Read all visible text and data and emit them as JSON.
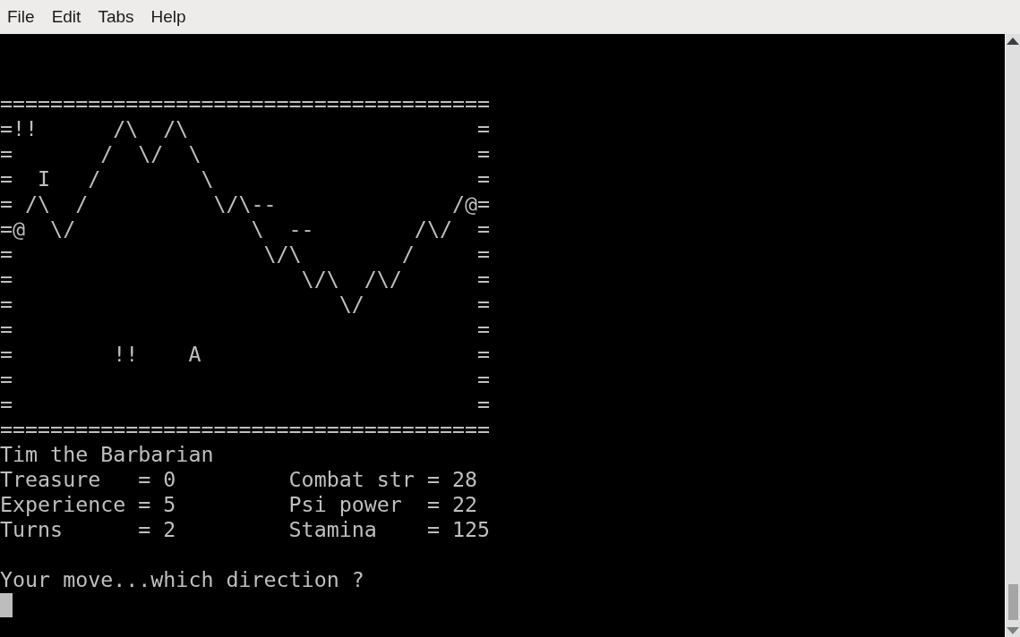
{
  "menu": [
    {
      "label": "File"
    },
    {
      "label": "Edit"
    },
    {
      "label": "Tabs"
    },
    {
      "label": "Help"
    }
  ],
  "terminal": {
    "lines": [
      {
        "kind": "text",
        "text": "======================================="
      },
      {
        "kind": "text",
        "text": "=!!      /\\  /\\                       ="
      },
      {
        "kind": "text",
        "text": "=       /  \\/  \\                      ="
      },
      {
        "kind": "text",
        "text": "=  I   /        \\                     ="
      },
      {
        "kind": "text",
        "text": "= /\\  /          \\/\\--              /@="
      },
      {
        "kind": "text",
        "text": "=@  \\/              \\  --        /\\/  ="
      },
      {
        "kind": "text",
        "text": "=                    \\/\\        /     ="
      },
      {
        "kind": "text",
        "text": "=                       \\/\\  /\\/      ="
      },
      {
        "kind": "text",
        "text": "=                          \\/         ="
      },
      {
        "kind": "text",
        "text": "=                                     ="
      },
      {
        "kind": "text",
        "text": "=        !!    A                      ="
      },
      {
        "kind": "text",
        "text": "=                                     ="
      },
      {
        "kind": "text",
        "text": "=                                     ="
      },
      {
        "kind": "text",
        "text": "======================================="
      },
      {
        "kind": "text",
        "text": "Tim the Barbarian"
      },
      {
        "kind": "text",
        "text": "Treasure   = 0         Combat str = 28"
      },
      {
        "kind": "text",
        "text": "Experience = 5         Psi power  = 22"
      },
      {
        "kind": "text",
        "text": "Turns      = 2         Stamina    = 125"
      },
      {
        "kind": "blank"
      },
      {
        "kind": "text",
        "text": "Your move...which direction ?"
      }
    ],
    "cursor": {
      "visible": true
    }
  }
}
